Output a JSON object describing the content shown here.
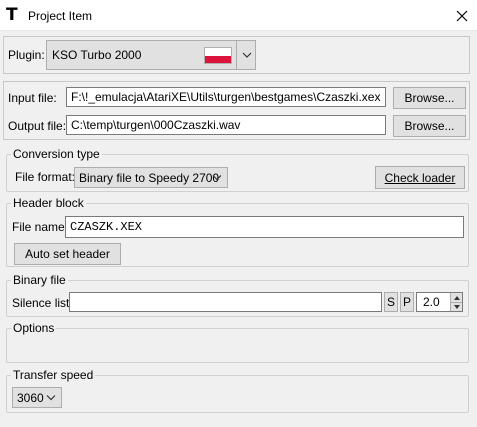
{
  "window": {
    "title": "Project Item"
  },
  "plugin": {
    "label": "Plugin:",
    "value": "KSO Turbo 2000",
    "flag_colors": {
      "top": "#ffffff",
      "bottom": "#dc143c"
    }
  },
  "files": {
    "input_label": "Input file:",
    "input_value": "F:\\!_emulacja\\AtariXE\\Utils\\turgen\\bestgames\\Czaszki.xex",
    "output_label": "Output file:",
    "output_value": "C:\\temp\\turgen\\000Czaszki.wav",
    "browse_label": "Browse..."
  },
  "conversion": {
    "title": "Conversion type",
    "format_label": "File format:",
    "format_value": "Binary file to Speedy 2700",
    "check_loader_label": "Check loader"
  },
  "header_block": {
    "title": "Header block",
    "file_name_label": "File name:",
    "file_name_value": "CZASZK.XEX",
    "auto_set_label": "Auto set header"
  },
  "binary_file": {
    "title": "Binary file",
    "silence_label": "Silence list:",
    "silence_value": "",
    "s_label": "S",
    "p_label": "P",
    "spin_value": "2.0"
  },
  "options": {
    "title": "Options"
  },
  "transfer": {
    "title": "Transfer speed",
    "value": "3060"
  }
}
